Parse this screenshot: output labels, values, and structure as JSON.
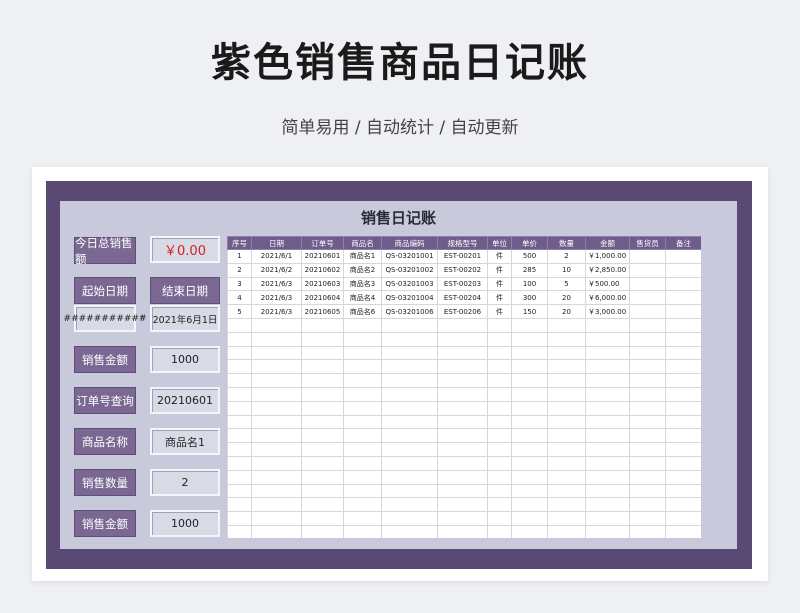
{
  "page": {
    "title": "紫色销售商品日记账",
    "subtitle": "简单易用 / 自动统计 / 自动更新"
  },
  "sheet": {
    "title": "销售日记账",
    "left_panel": {
      "today_total_label": "今日总销售额",
      "today_total_value": "￥0.00",
      "start_date_label": "起始日期",
      "start_date_value": "###########",
      "date_separator": "-",
      "end_date_label": "结束日期",
      "end_date_value": "2021年6月1日",
      "sales_amount_label": "销售金额",
      "sales_amount_value": "1000",
      "order_query_label": "订单号查询",
      "order_query_value": "20210601",
      "product_name_label": "商品名称",
      "product_name_value": "商品名1",
      "sales_qty_label": "销售数量",
      "sales_qty_value": "2",
      "sales_amount2_label": "销售金额",
      "sales_amount2_value": "1000"
    },
    "table": {
      "headers": [
        "序号",
        "日期",
        "订单号",
        "商品名",
        "商品编码",
        "规格型号",
        "单位",
        "单价",
        "数量",
        "金额",
        "售货员",
        "备注"
      ],
      "rows": [
        [
          "1",
          "2021/6/1",
          "20210601",
          "商品名1",
          "QS-03201001",
          "EST-00201",
          "件",
          "500",
          "2",
          "￥1,000.00",
          "",
          ""
        ],
        [
          "2",
          "2021/6/2",
          "20210602",
          "商品名2",
          "QS-03201002",
          "EST-00202",
          "件",
          "285",
          "10",
          "￥2,850.00",
          "",
          ""
        ],
        [
          "3",
          "2021/6/3",
          "20210603",
          "商品名3",
          "QS-03201003",
          "EST-00203",
          "件",
          "100",
          "5",
          "￥500.00",
          "",
          ""
        ],
        [
          "4",
          "2021/6/3",
          "20210604",
          "商品名4",
          "QS-03201004",
          "EST-00204",
          "件",
          "300",
          "20",
          "￥6,000.00",
          "",
          ""
        ],
        [
          "5",
          "2021/6/3",
          "20210605",
          "商品名6",
          "QS-03201006",
          "EST-00206",
          "件",
          "150",
          "20",
          "￥3,000.00",
          "",
          ""
        ]
      ],
      "empty_rows": 16
    }
  }
}
